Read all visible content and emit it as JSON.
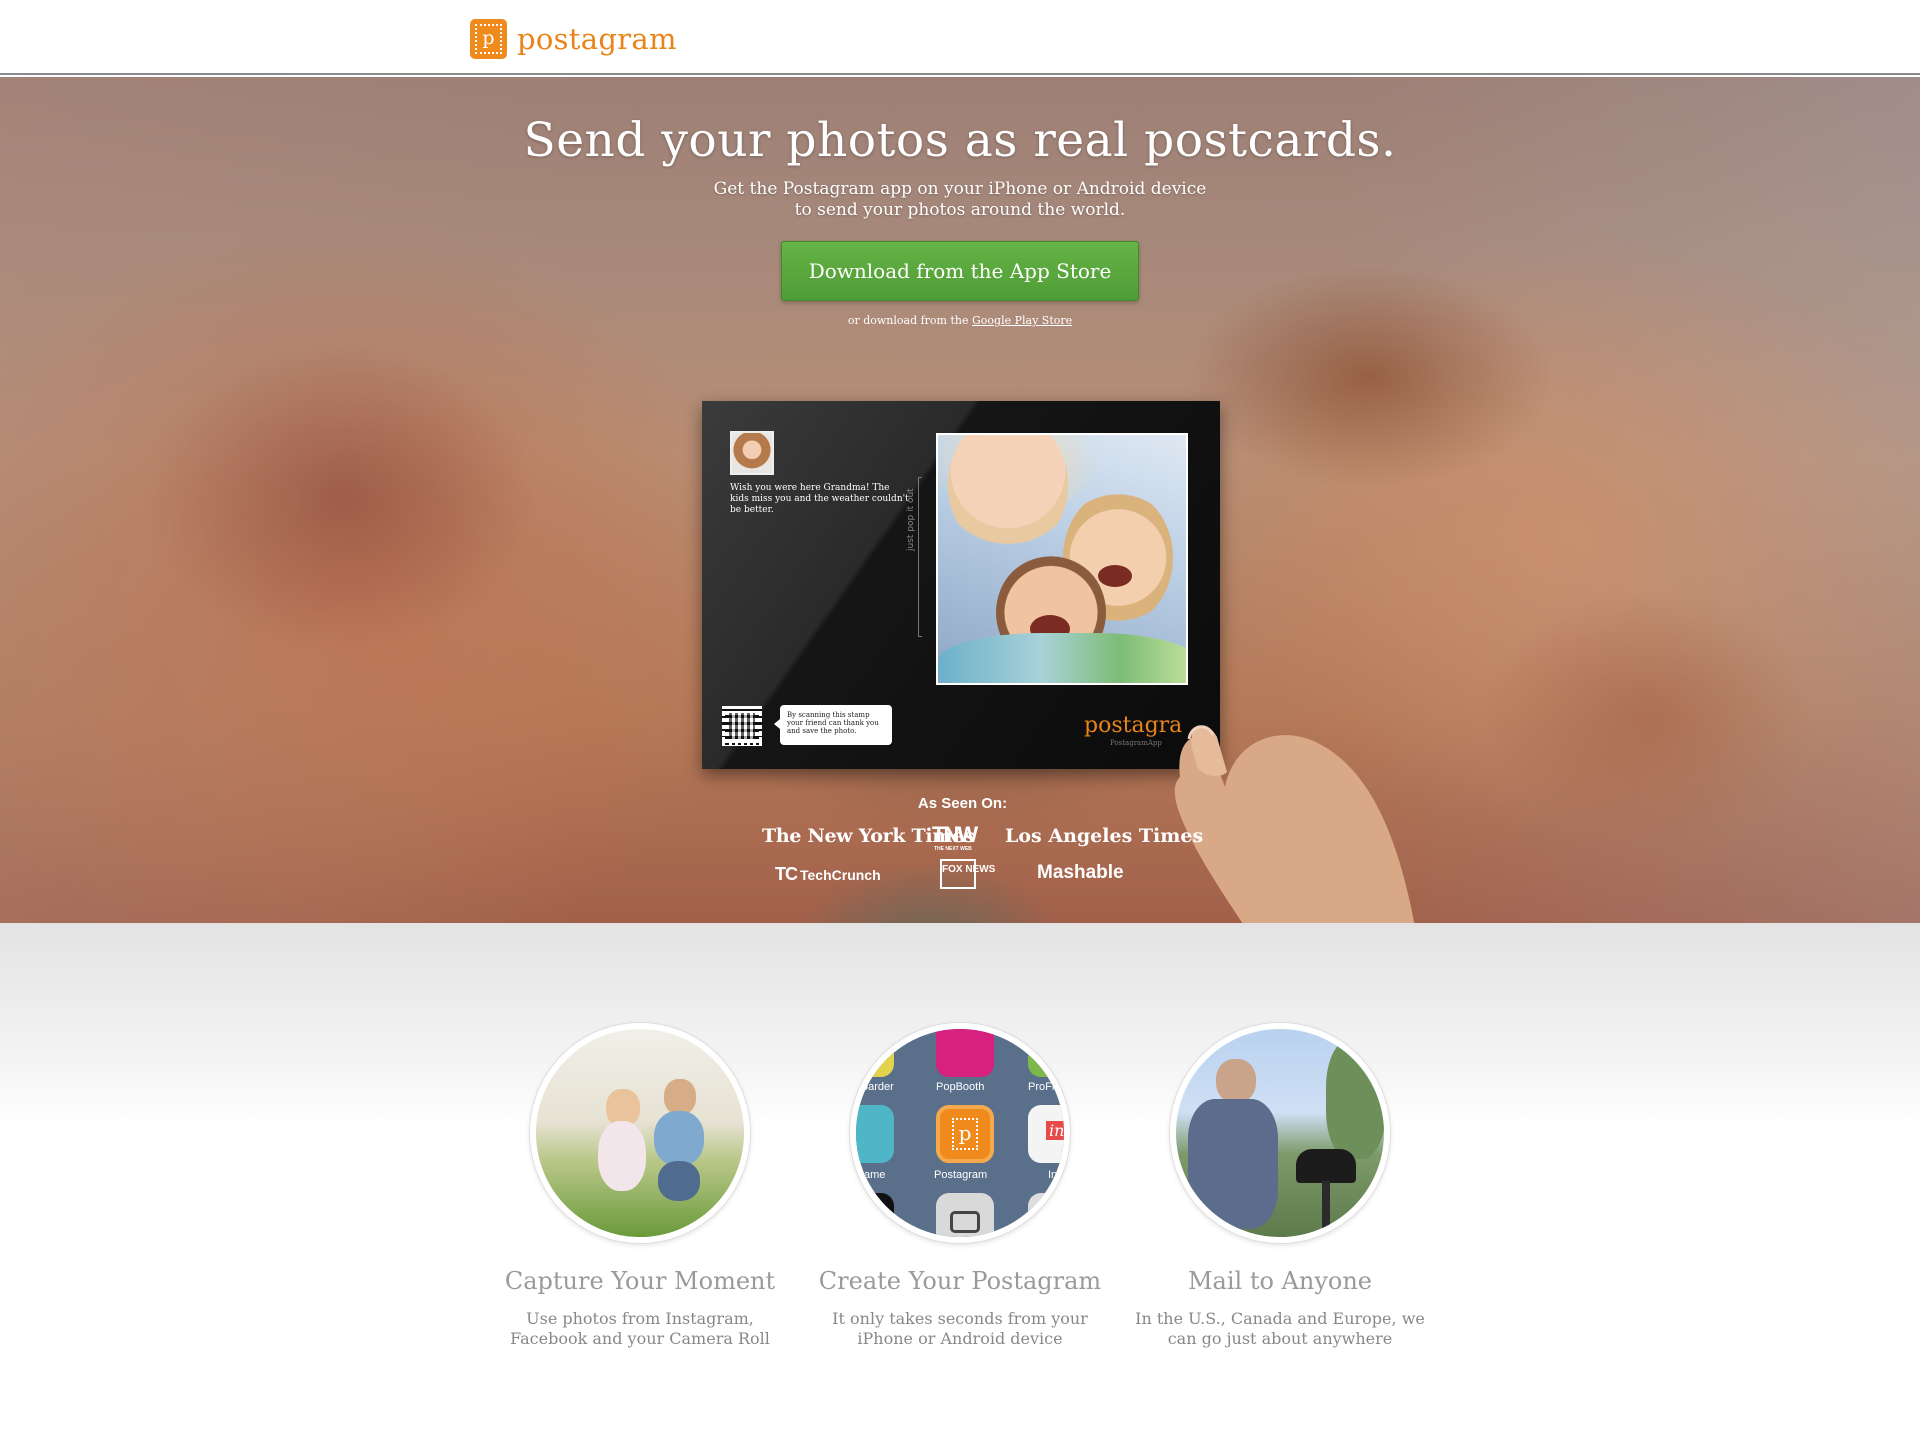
{
  "header": {
    "brand_name": "postagram",
    "brand_letter": "p"
  },
  "hero": {
    "title": "Send your photos as real postcards.",
    "subtitle_line1": "Get the Postagram app on your iPhone or Android device",
    "subtitle_line2": "to send your photos around the world.",
    "cta_label": "Download from the App Store",
    "alt_prefix": "or download from the",
    "alt_link": "Google Play Store"
  },
  "postcard": {
    "message": "Wish you were here Grandma! The kids miss you and the weather couldn't be better.",
    "pop_out": "just pop it out",
    "qr_note": "By scanning this stamp your friend can thank you and save the photo.",
    "logo": "postagra",
    "url": "PostagramApp"
  },
  "press": {
    "title": "As Seen On:",
    "outlets": [
      "The New York Times",
      "TNW",
      "Los Angeles Times",
      "TechCrunch",
      "FOX NEWS",
      "Mashable"
    ],
    "tnw_sub": "THE NEXT WEB",
    "tc_mark": "TC"
  },
  "features": [
    {
      "title": "Capture Your Moment",
      "desc": "Use photos from Instagram, Facebook and your Camera Roll"
    },
    {
      "title": "Create Your Postagram",
      "desc": "It only takes seconds from your iPhone or Android device"
    },
    {
      "title": "Mail to Anyone",
      "desc": "In the U.S., Canada and Europe, we can go just about anywhere"
    }
  ],
  "phone_apps": {
    "left_top": "oarder",
    "popbooth": "PopBooth",
    "right_top": "ProFl",
    "left_mid": "ame",
    "postagram": "Postagram",
    "right_mid": "In",
    "ink": "ink"
  },
  "colors": {
    "brand_orange": "#e98418",
    "cta_green": "#5aa83e"
  }
}
